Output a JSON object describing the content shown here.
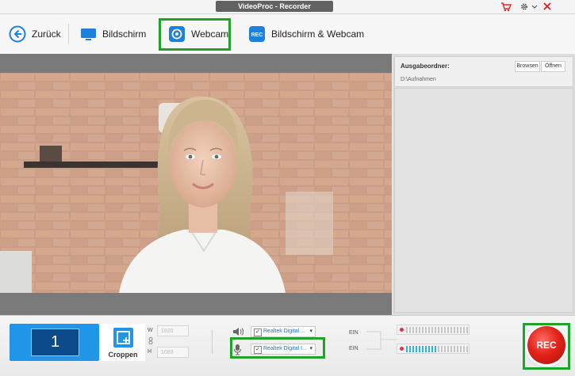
{
  "window": {
    "title": "VideoProc - Recorder"
  },
  "toolbar": {
    "back": "Zurück",
    "screen": "Bildschirm",
    "webcam": "Webcam",
    "screen_webcam": "Bildschirm & Webcam"
  },
  "output": {
    "label": "Ausgabeordner:",
    "path": "D:\\Aufnahmen",
    "browse": "Browsen",
    "open": "Öffnen"
  },
  "bottom": {
    "monitor_number": "1",
    "crop_label": "Croppen",
    "width_label": "W",
    "width_value": "1920",
    "height_label": "H",
    "height_value": "1080",
    "speaker_device": "Realtek Digital ...",
    "mic_device": "Realtek Digital I...",
    "speaker_state": "EIN",
    "mic_state": "EIN",
    "mic_level": 0.48,
    "rec_label": "REC"
  },
  "colors": {
    "accent": "#2196e8",
    "highlight": "#1fa32a",
    "record": "#e2231a"
  }
}
